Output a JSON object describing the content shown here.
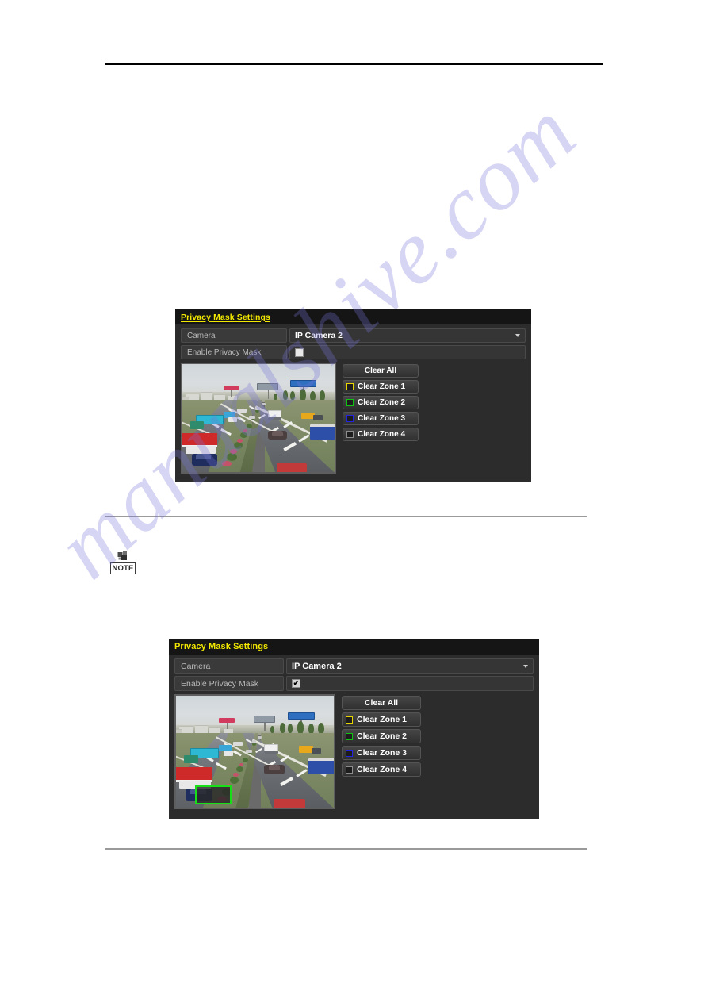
{
  "page": {
    "watermark_text": "manualshive.com",
    "note_icon_label": "NOTE"
  },
  "dialogs": [
    {
      "id": "dialog-1",
      "title": "Privacy Mask Settings",
      "fields": {
        "camera_label": "Camera",
        "camera_value": "IP Camera 2",
        "enable_label": "Enable Privacy Mask",
        "enable_checked": false,
        "enable_checkmark": "✔"
      },
      "buttons": {
        "clear_all": "Clear All",
        "zones": [
          {
            "label": "Clear Zone 1",
            "color": "#e8d400"
          },
          {
            "label": "Clear Zone 2",
            "color": "#13c313"
          },
          {
            "label": "Clear Zone 3",
            "color": "#2323e0"
          },
          {
            "label": "Clear Zone 4",
            "color": "#8d8d8d"
          }
        ]
      },
      "preview": {
        "scene": "highway-traffic-camera-view",
        "mask_visible": false
      }
    },
    {
      "id": "dialog-2",
      "title": "Privacy Mask Settings",
      "fields": {
        "camera_label": "Camera",
        "camera_value": "IP Camera 2",
        "enable_label": "Enable Privacy Mask",
        "enable_checked": true,
        "enable_checkmark": "✔"
      },
      "buttons": {
        "clear_all": "Clear All",
        "zones": [
          {
            "label": "Clear Zone 1",
            "color": "#e8d400"
          },
          {
            "label": "Clear Zone 2",
            "color": "#13c313"
          },
          {
            "label": "Clear Zone 3",
            "color": "#2323e0"
          },
          {
            "label": "Clear Zone 4",
            "color": "#8d8d8d"
          }
        ]
      },
      "preview": {
        "scene": "highway-traffic-camera-view",
        "mask_visible": true,
        "mask_color": "#18e018"
      }
    }
  ]
}
